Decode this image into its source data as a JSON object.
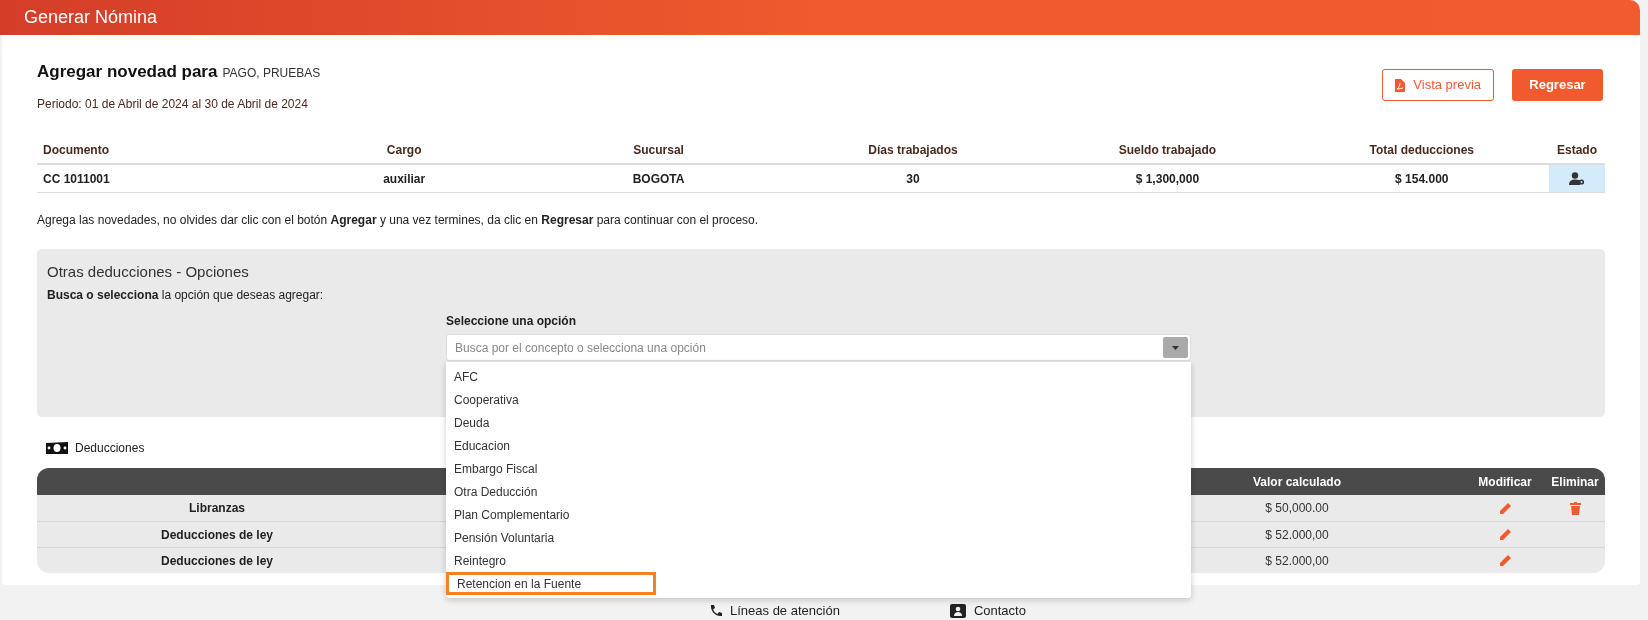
{
  "header": {
    "title": "Generar Nómina"
  },
  "heading": {
    "title": "Agregar novedad para",
    "employee": "PAGO, PRUEBAS",
    "period": "Periodo: 01 de Abril de 2024 al 30 de Abril de 2024"
  },
  "buttons": [
    {
      "kind": "outline",
      "label": "Vista previa"
    },
    {
      "kind": "primary",
      "label": "Regresar"
    }
  ],
  "summary": {
    "columns": [
      "Documento",
      "Cargo",
      "Sucursal",
      "Días trabajados",
      "Sueldo trabajado",
      "Total deducciones",
      "Estado"
    ],
    "row": [
      "CC 1011001",
      "auxiliar",
      "BOGOTA",
      "30",
      "$ 1,300,000",
      "$ 154.000"
    ]
  },
  "instructions": "Agrega las novedades, no olvides dar clic con el botón **Agregar** y una vez termines, da clic en **Regresar** para continuar con el proceso.",
  "options_panel": {
    "title": "Otras deducciones - Opciones",
    "hint": "**Busca o selecciona** la opción que deseas agregar:",
    "select_label": "Seleccione una opción",
    "placeholder": "Busca por el concepto o selecciona una opción",
    "dropdown": [
      {
        "label": "AFC",
        "selected": false
      },
      {
        "label": "Cooperativa",
        "selected": false
      },
      {
        "label": "Deuda",
        "selected": false
      },
      {
        "label": "Educacion",
        "selected": false
      },
      {
        "label": "Embargo Fiscal",
        "selected": false
      },
      {
        "label": "Otra Deducción",
        "selected": false
      },
      {
        "label": "Plan Complementario",
        "selected": false
      },
      {
        "label": "Pensión Voluntaria",
        "selected": false
      },
      {
        "label": "Reintegro",
        "selected": false
      },
      {
        "label": "Retencion en la Fuente",
        "selected": true
      }
    ]
  },
  "deductions": {
    "title": "Deducciones",
    "columns": [
      "Valor calculado",
      "Modificar",
      "Eliminar"
    ],
    "rows": [
      {
        "name": "Libranzas",
        "value": "$ 50,000.00",
        "deletable": true
      },
      {
        "name": "Deducciones de ley",
        "value": "$ 52.000,00",
        "deletable": false
      },
      {
        "name": "Deducciones de ley",
        "value": "$ 52.000,00",
        "deletable": false
      }
    ]
  },
  "footer": [
    {
      "kind": "phone",
      "label": "Líneas de atención"
    },
    {
      "kind": "contact",
      "label": "Contacto"
    }
  ]
}
